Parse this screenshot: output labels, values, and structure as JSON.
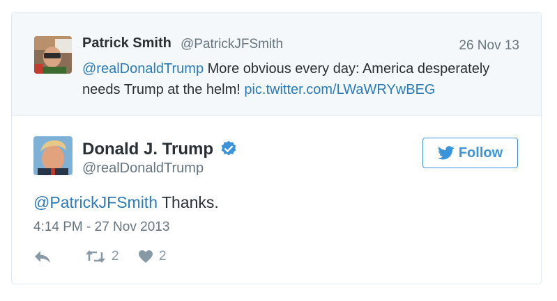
{
  "parent_tweet": {
    "name": "Patrick Smith",
    "handle": "@PatrickJFSmith",
    "date": "26 Nov 13",
    "mention": "@realDonaldTrump",
    "text": " More obvious every day: America desperately needs Trump at the helm! ",
    "link": "pic.twitter.com/LWaWRYwBEG"
  },
  "main_tweet": {
    "name": "Donald J. Trump",
    "handle": "@realDonaldTrump",
    "follow_label": "Follow",
    "mention": "@PatrickJFSmith",
    "text": " Thanks.",
    "timestamp": "4:14 PM - 27 Nov 2013",
    "retweet_count": "2",
    "like_count": "2"
  },
  "colors": {
    "link": "#2b7bb9",
    "verified": "#3b94d9",
    "follow_border": "#3b94d9",
    "parent_bg": "#f5f8fa"
  },
  "icons": {
    "verified": "verified-badge-icon",
    "follow": "twitter-bird-icon",
    "reply": "reply-icon",
    "retweet": "retweet-icon",
    "like": "heart-icon"
  }
}
